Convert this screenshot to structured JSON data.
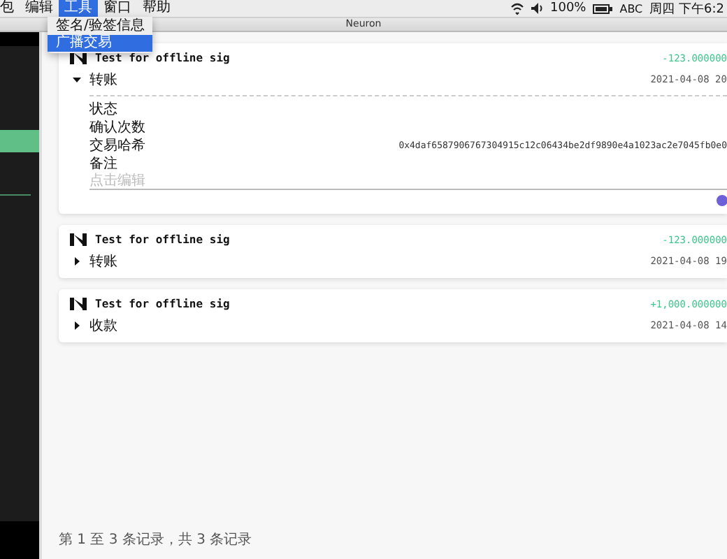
{
  "menu_bar": {
    "items": [
      {
        "label": "包",
        "selected": false
      },
      {
        "label": "编辑",
        "selected": false
      },
      {
        "label": "工具",
        "selected": true
      },
      {
        "label": "窗口",
        "selected": false
      },
      {
        "label": "帮助",
        "selected": false
      }
    ],
    "dropdown": [
      {
        "label": "签名/验签信息",
        "selected": false
      },
      {
        "label": "广播交易",
        "selected": true
      }
    ],
    "battery": "100%",
    "input_source": "ABC",
    "clock": "周四 下午6:2"
  },
  "window": {
    "title": "Neuron"
  },
  "transactions": [
    {
      "title": "Test for offline sig",
      "type": "转账",
      "expanded": true,
      "amount": "-123.000000",
      "time": "2021-04-08 20",
      "details": [
        {
          "label": "状态"
        },
        {
          "label": "确认次数"
        },
        {
          "label": "交易哈希",
          "value": "0x4daf6587906767304915c12c06434be2df9890e4a1023ac2e7045fb0e0"
        },
        {
          "label": "备注"
        }
      ],
      "note_placeholder": "点击编辑"
    },
    {
      "title": "Test for offline sig",
      "type": "转账",
      "expanded": false,
      "amount": "-123.000000",
      "time": "2021-04-08 19"
    },
    {
      "title": "Test for offline sig",
      "type": "收款",
      "expanded": false,
      "amount": "+1,000.000000",
      "time": "2021-04-08 14"
    }
  ],
  "footer": "第 1 至 3 条记录，共 3 条记录"
}
